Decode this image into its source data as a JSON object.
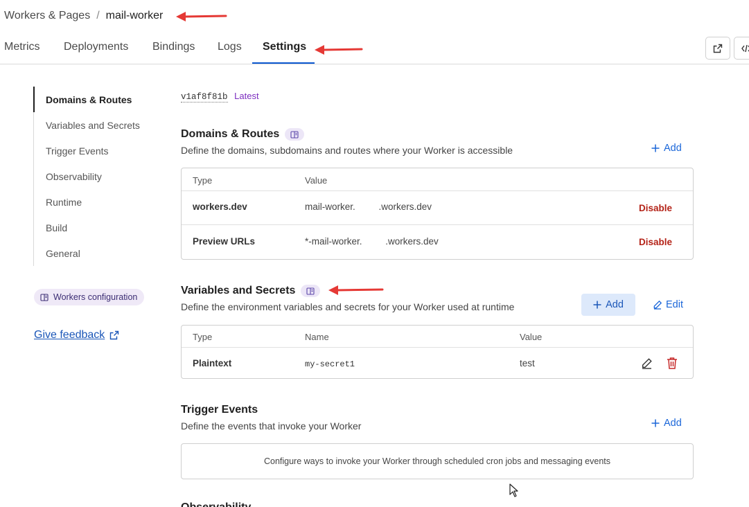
{
  "breadcrumb": {
    "parent": "Workers & Pages",
    "separator": "/",
    "current": "mail-worker"
  },
  "tabs": [
    {
      "label": "Metrics"
    },
    {
      "label": "Deployments"
    },
    {
      "label": "Bindings"
    },
    {
      "label": "Logs"
    },
    {
      "label": "Settings",
      "active": true
    }
  ],
  "top_actions": {
    "open_external_icon": "external-link-icon",
    "code_icon": "code-icon"
  },
  "sidebar": {
    "items": [
      {
        "label": "Domains & Routes",
        "active": true
      },
      {
        "label": "Variables and Secrets"
      },
      {
        "label": "Trigger Events"
      },
      {
        "label": "Observability"
      },
      {
        "label": "Runtime"
      },
      {
        "label": "Build"
      },
      {
        "label": "General"
      }
    ],
    "config_pill": "Workers configuration",
    "feedback": "Give feedback"
  },
  "version": {
    "hash": "v1af8f81b",
    "tag": "Latest"
  },
  "domains": {
    "title": "Domains & Routes",
    "description": "Define the domains, subdomains and routes where your Worker is accessible",
    "add_label": "Add",
    "headers": [
      "Type",
      "Value"
    ],
    "rows": [
      {
        "type": "workers.dev",
        "value": "mail-worker.         .workers.dev",
        "action": "Disable"
      },
      {
        "type": "Preview URLs",
        "value": "*-mail-worker.         .workers.dev",
        "action": "Disable"
      }
    ]
  },
  "variables": {
    "title": "Variables and Secrets",
    "description": "Define the environment variables and secrets for your Worker used at runtime",
    "add_label": "Add",
    "edit_label": "Edit",
    "headers": [
      "Type",
      "Name",
      "Value"
    ],
    "rows": [
      {
        "type": "Plaintext",
        "name": "my-secret1",
        "value": "test"
      }
    ]
  },
  "triggers": {
    "title": "Trigger Events",
    "description": "Define the events that invoke your Worker",
    "add_label": "Add",
    "empty_text": "Configure ways to invoke your Worker through scheduled cron jobs and messaging events"
  },
  "next_section_title": "Observability",
  "colors": {
    "accent": "#0b57d0",
    "link": "#1a66d9",
    "danger": "#b42318",
    "annotation_arrow": "#e53935",
    "tag_purple": "#7b2cbf"
  }
}
